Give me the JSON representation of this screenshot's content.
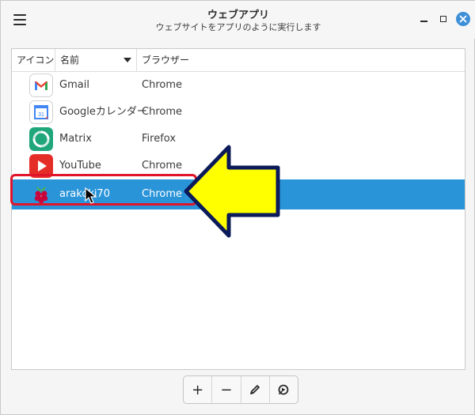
{
  "window": {
    "title": "ウェブアプリ",
    "subtitle": "ウェブサイトをアプリのように実行します"
  },
  "header_icons": {
    "menu": "hamburger-menu-icon",
    "minimize": "minimize-icon",
    "maximize": "maximize-icon",
    "close": "close-icon"
  },
  "columns": {
    "icon": "アイコン",
    "name": "名前",
    "browser": "ブラウザー"
  },
  "apps": [
    {
      "name": "Gmail",
      "browser": "Chrome",
      "icon": "gmail-icon",
      "selected": false
    },
    {
      "name": "Googleカレンダー",
      "browser": "Chrome",
      "icon": "google-calendar-icon",
      "selected": false
    },
    {
      "name": "Matrix",
      "browser": "Firefox",
      "icon": "matrix-icon",
      "selected": false
    },
    {
      "name": "YouTube",
      "browser": "Chrome",
      "icon": "youtube-icon",
      "selected": false
    },
    {
      "name": "arakoki70",
      "browser": "Chrome",
      "icon": "raspberry-pi-icon",
      "selected": true
    }
  ],
  "toolbar": {
    "add": "+",
    "remove": "−",
    "edit_icon": "pencil-icon",
    "run_icon": "launch-icon"
  },
  "colors": {
    "selection": "#2a94d8",
    "highlight_outline": "#e0152a",
    "annotation_arrow": "#ffff00",
    "close_button": "#3d8fd8"
  }
}
